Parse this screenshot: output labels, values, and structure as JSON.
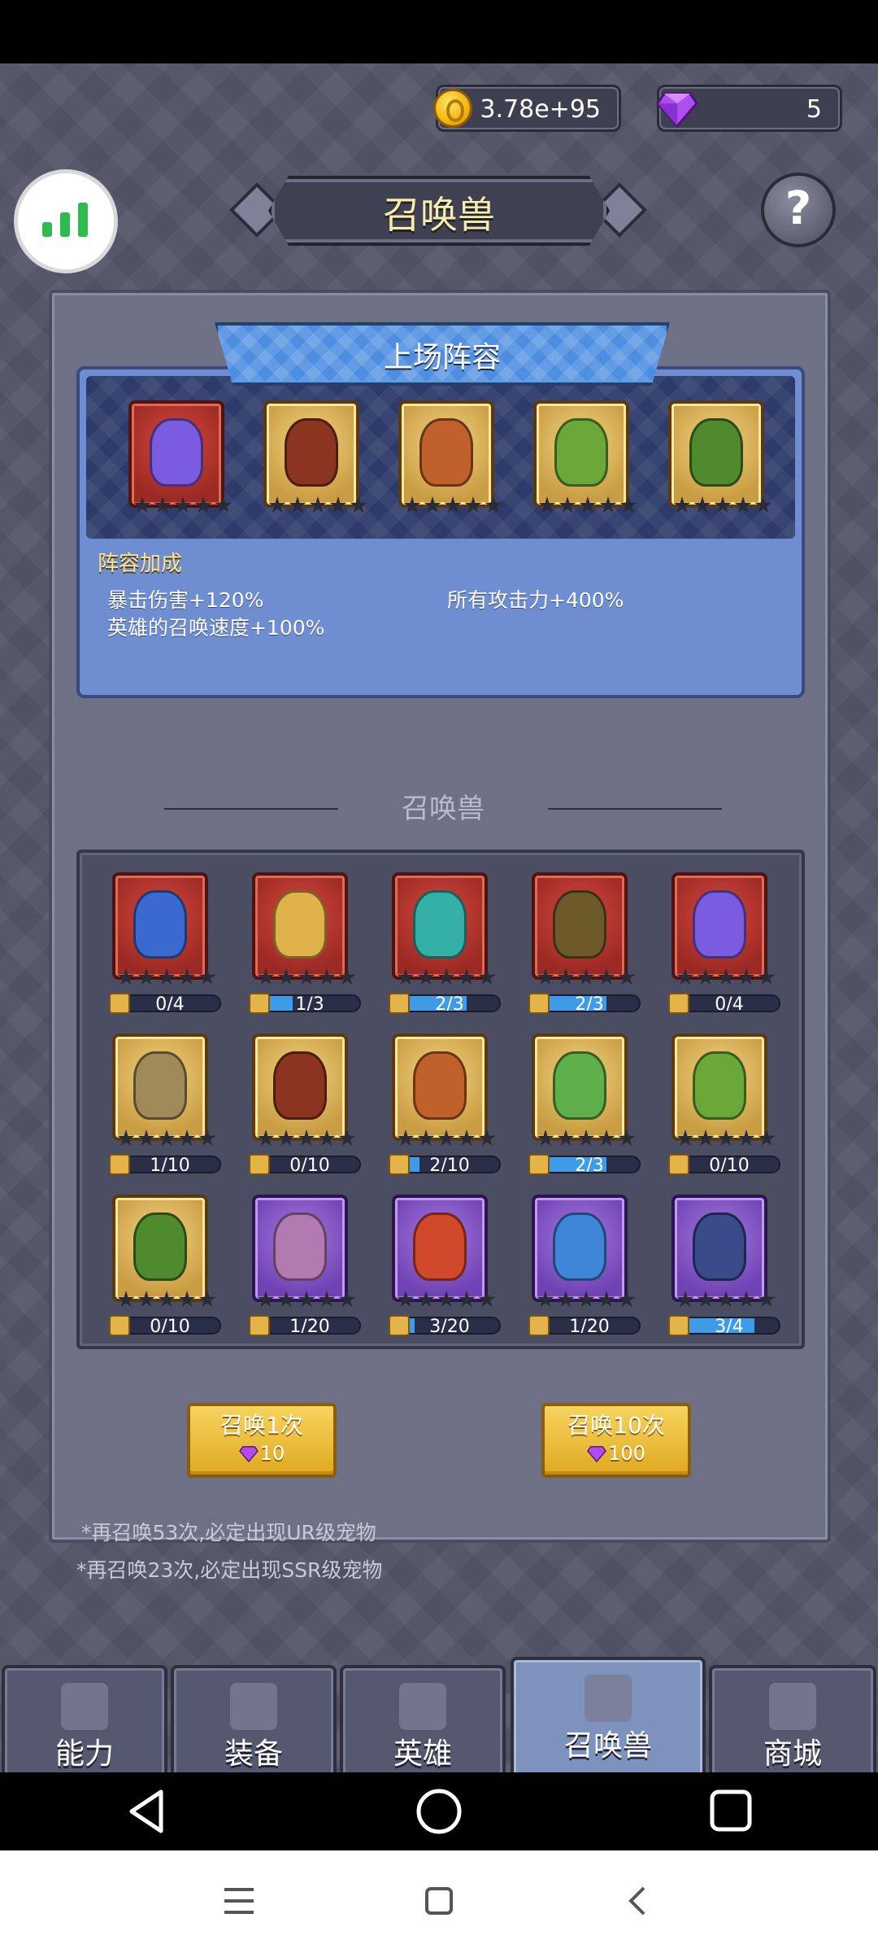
{
  "currency": {
    "coins": "3.78e+95",
    "gems": "5"
  },
  "title": "召唤兽",
  "help_label": "?",
  "lineup": {
    "title": "上场阵容",
    "bonus_title": "阵容加成",
    "bonuses": [
      "暴击伤害+120%",
      "所有攻击力+400%",
      "英雄的召唤速度+100%"
    ]
  },
  "section_label": "召唤兽",
  "monsters": [
    {
      "progress": "0/4",
      "ratio": 0.0,
      "icon": "lion-beast-icon"
    },
    {
      "progress": "1/3",
      "ratio": 0.33,
      "icon": "mage-icon"
    },
    {
      "progress": "2/3",
      "ratio": 0.67,
      "icon": "tentacle-eye-icon"
    },
    {
      "progress": "2/3",
      "ratio": 0.67,
      "icon": "ogre-icon"
    },
    {
      "progress": "0/4",
      "ratio": 0.0,
      "icon": "fire-demon-icon"
    },
    {
      "progress": "1/10",
      "ratio": 0.1,
      "icon": "dragon-icon"
    },
    {
      "progress": "0/10",
      "ratio": 0.0,
      "icon": "bat-icon"
    },
    {
      "progress": "2/10",
      "ratio": 0.2,
      "icon": "armored-knight-icon"
    },
    {
      "progress": "2/3",
      "ratio": 0.67,
      "icon": "plant-sprite-icon"
    },
    {
      "progress": "0/10",
      "ratio": 0.0,
      "icon": "flower-fairy-icon"
    },
    {
      "progress": "0/10",
      "ratio": 0.0,
      "icon": "winged-insect-icon"
    },
    {
      "progress": "1/20",
      "ratio": 0.05,
      "icon": "pig-beast-icon"
    },
    {
      "progress": "3/20",
      "ratio": 0.15,
      "icon": "flame-bird-icon"
    },
    {
      "progress": "1/20",
      "ratio": 0.05,
      "icon": "mushroom-icon"
    },
    {
      "progress": "3/4",
      "ratio": 0.75,
      "icon": "shark-icon"
    }
  ],
  "summon": {
    "one": {
      "label": "召唤1次",
      "cost": "10"
    },
    "ten": {
      "label": "召唤10次",
      "cost": "100"
    }
  },
  "notes": [
    "*再召唤53次,必定出现UR级宠物",
    "*再召唤23次,必定出现SSR级宠物"
  ],
  "tabs": [
    "能力",
    "装备",
    "英雄",
    "召唤兽",
    "商城"
  ],
  "colors": {
    "background": "#55576a",
    "gold": "#e0a920",
    "lineup_blue": "#6f8ed2",
    "active_tab": "#7d93bd"
  }
}
